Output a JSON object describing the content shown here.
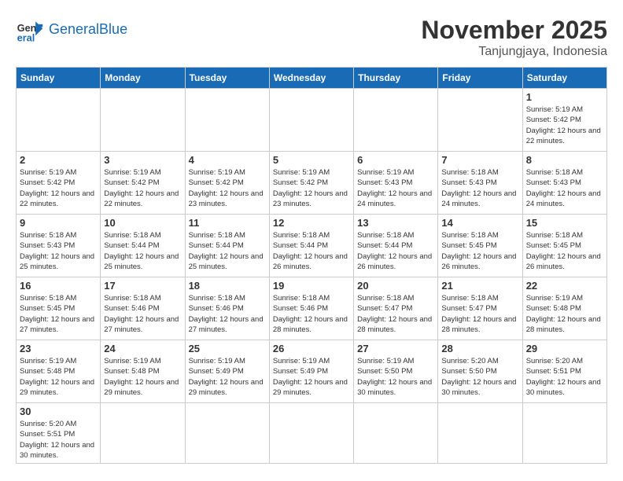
{
  "header": {
    "logo_general": "General",
    "logo_blue": "Blue",
    "month_title": "November 2025",
    "location": "Tanjungjaya, Indonesia"
  },
  "weekdays": [
    "Sunday",
    "Monday",
    "Tuesday",
    "Wednesday",
    "Thursday",
    "Friday",
    "Saturday"
  ],
  "days": {
    "1": {
      "sunrise": "5:19 AM",
      "sunset": "5:42 PM",
      "daylight": "12 hours and 22 minutes."
    },
    "2": {
      "sunrise": "5:19 AM",
      "sunset": "5:42 PM",
      "daylight": "12 hours and 22 minutes."
    },
    "3": {
      "sunrise": "5:19 AM",
      "sunset": "5:42 PM",
      "daylight": "12 hours and 22 minutes."
    },
    "4": {
      "sunrise": "5:19 AM",
      "sunset": "5:42 PM",
      "daylight": "12 hours and 23 minutes."
    },
    "5": {
      "sunrise": "5:19 AM",
      "sunset": "5:42 PM",
      "daylight": "12 hours and 23 minutes."
    },
    "6": {
      "sunrise": "5:19 AM",
      "sunset": "5:43 PM",
      "daylight": "12 hours and 24 minutes."
    },
    "7": {
      "sunrise": "5:18 AM",
      "sunset": "5:43 PM",
      "daylight": "12 hours and 24 minutes."
    },
    "8": {
      "sunrise": "5:18 AM",
      "sunset": "5:43 PM",
      "daylight": "12 hours and 24 minutes."
    },
    "9": {
      "sunrise": "5:18 AM",
      "sunset": "5:43 PM",
      "daylight": "12 hours and 25 minutes."
    },
    "10": {
      "sunrise": "5:18 AM",
      "sunset": "5:44 PM",
      "daylight": "12 hours and 25 minutes."
    },
    "11": {
      "sunrise": "5:18 AM",
      "sunset": "5:44 PM",
      "daylight": "12 hours and 25 minutes."
    },
    "12": {
      "sunrise": "5:18 AM",
      "sunset": "5:44 PM",
      "daylight": "12 hours and 26 minutes."
    },
    "13": {
      "sunrise": "5:18 AM",
      "sunset": "5:44 PM",
      "daylight": "12 hours and 26 minutes."
    },
    "14": {
      "sunrise": "5:18 AM",
      "sunset": "5:45 PM",
      "daylight": "12 hours and 26 minutes."
    },
    "15": {
      "sunrise": "5:18 AM",
      "sunset": "5:45 PM",
      "daylight": "12 hours and 26 minutes."
    },
    "16": {
      "sunrise": "5:18 AM",
      "sunset": "5:45 PM",
      "daylight": "12 hours and 27 minutes."
    },
    "17": {
      "sunrise": "5:18 AM",
      "sunset": "5:46 PM",
      "daylight": "12 hours and 27 minutes."
    },
    "18": {
      "sunrise": "5:18 AM",
      "sunset": "5:46 PM",
      "daylight": "12 hours and 27 minutes."
    },
    "19": {
      "sunrise": "5:18 AM",
      "sunset": "5:46 PM",
      "daylight": "12 hours and 28 minutes."
    },
    "20": {
      "sunrise": "5:18 AM",
      "sunset": "5:47 PM",
      "daylight": "12 hours and 28 minutes."
    },
    "21": {
      "sunrise": "5:18 AM",
      "sunset": "5:47 PM",
      "daylight": "12 hours and 28 minutes."
    },
    "22": {
      "sunrise": "5:19 AM",
      "sunset": "5:48 PM",
      "daylight": "12 hours and 28 minutes."
    },
    "23": {
      "sunrise": "5:19 AM",
      "sunset": "5:48 PM",
      "daylight": "12 hours and 29 minutes."
    },
    "24": {
      "sunrise": "5:19 AM",
      "sunset": "5:48 PM",
      "daylight": "12 hours and 29 minutes."
    },
    "25": {
      "sunrise": "5:19 AM",
      "sunset": "5:49 PM",
      "daylight": "12 hours and 29 minutes."
    },
    "26": {
      "sunrise": "5:19 AM",
      "sunset": "5:49 PM",
      "daylight": "12 hours and 29 minutes."
    },
    "27": {
      "sunrise": "5:19 AM",
      "sunset": "5:50 PM",
      "daylight": "12 hours and 30 minutes."
    },
    "28": {
      "sunrise": "5:20 AM",
      "sunset": "5:50 PM",
      "daylight": "12 hours and 30 minutes."
    },
    "29": {
      "sunrise": "5:20 AM",
      "sunset": "5:51 PM",
      "daylight": "12 hours and 30 minutes."
    },
    "30": {
      "sunrise": "5:20 AM",
      "sunset": "5:51 PM",
      "daylight": "12 hours and 30 minutes."
    }
  }
}
